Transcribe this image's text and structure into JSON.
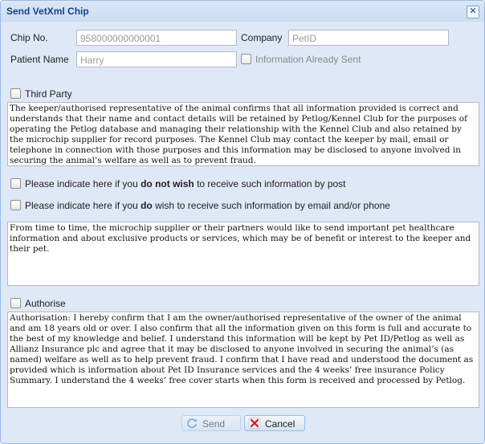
{
  "window": {
    "title": "Send VetXml Chip",
    "close_icon": "close-icon"
  },
  "form": {
    "chip_no": {
      "label": "Chip No.",
      "value": "958000000000001"
    },
    "company": {
      "label": "Company",
      "value": "PetID"
    },
    "patient_name": {
      "label": "Patient Name",
      "value": "Harry"
    },
    "information_already_sent": {
      "label": "Information Already Sent",
      "checked": false
    },
    "third_party": {
      "label": "Third Party",
      "checked": false
    },
    "third_party_text": "The keeper/authorised representative of the animal confirms that all information provided is correct and understands that their name and contact details will be retained by Petlog/Kennel Club for the purposes of operating the Petlog database and managing their relationship with the Kennel Club and also retained by the microchip supplier for record purposes. The Kennel Club may contact the keeper by mail, email or telephone in connection with those purposes and this information may be disclosed to anyone involved in securing the animal’s welfare as well as to prevent fraud.",
    "opt_out_post": {
      "prefix": "Please indicate here if you ",
      "emphasis": "do not wish",
      "suffix": " to receive such information by post",
      "checked": false
    },
    "opt_in_email": {
      "prefix": "Please indicate here if you ",
      "emphasis": "do",
      "suffix": " wish to receive such information by email and/or phone",
      "checked": false
    },
    "marketing_text": "From time to time, the microchip supplier or their partners would like to send important pet healthcare information and about exclusive products or services, which may be of benefit or interest to the keeper and their pet.",
    "authorise": {
      "label": "Authorise",
      "checked": false
    },
    "authorise_text": "Authorisation: I hereby confirm that I am the owner/authorised representative of the owner of the animal and am 18 years old or over. I also confirm that all the information given on this form is full and accurate to the best of my knowledge and belief. I understand this information will be kept by Pet ID/Petlog as well as Allianz Insurance plc and agree that it may be disclosed to anyone involved in securing the animal’s (as named) welfare as well as to help prevent fraud. I confirm that I have read and understood the document as provided which is information about Pet ID Insurance services and the 4 weeks’ free insurance Policy Summary. I understand the 4 weeks’ free cover starts when this form is received and processed by Petlog."
  },
  "buttons": {
    "send": {
      "label": "Send",
      "icon": "refresh-icon",
      "enabled": false
    },
    "cancel": {
      "label": "Cancel",
      "icon": "cross-icon"
    }
  },
  "colors": {
    "window_bg": "#dfe8f6",
    "title": "#15428b",
    "border": "#99bbe8",
    "cancel_icon": "#d0262b"
  }
}
